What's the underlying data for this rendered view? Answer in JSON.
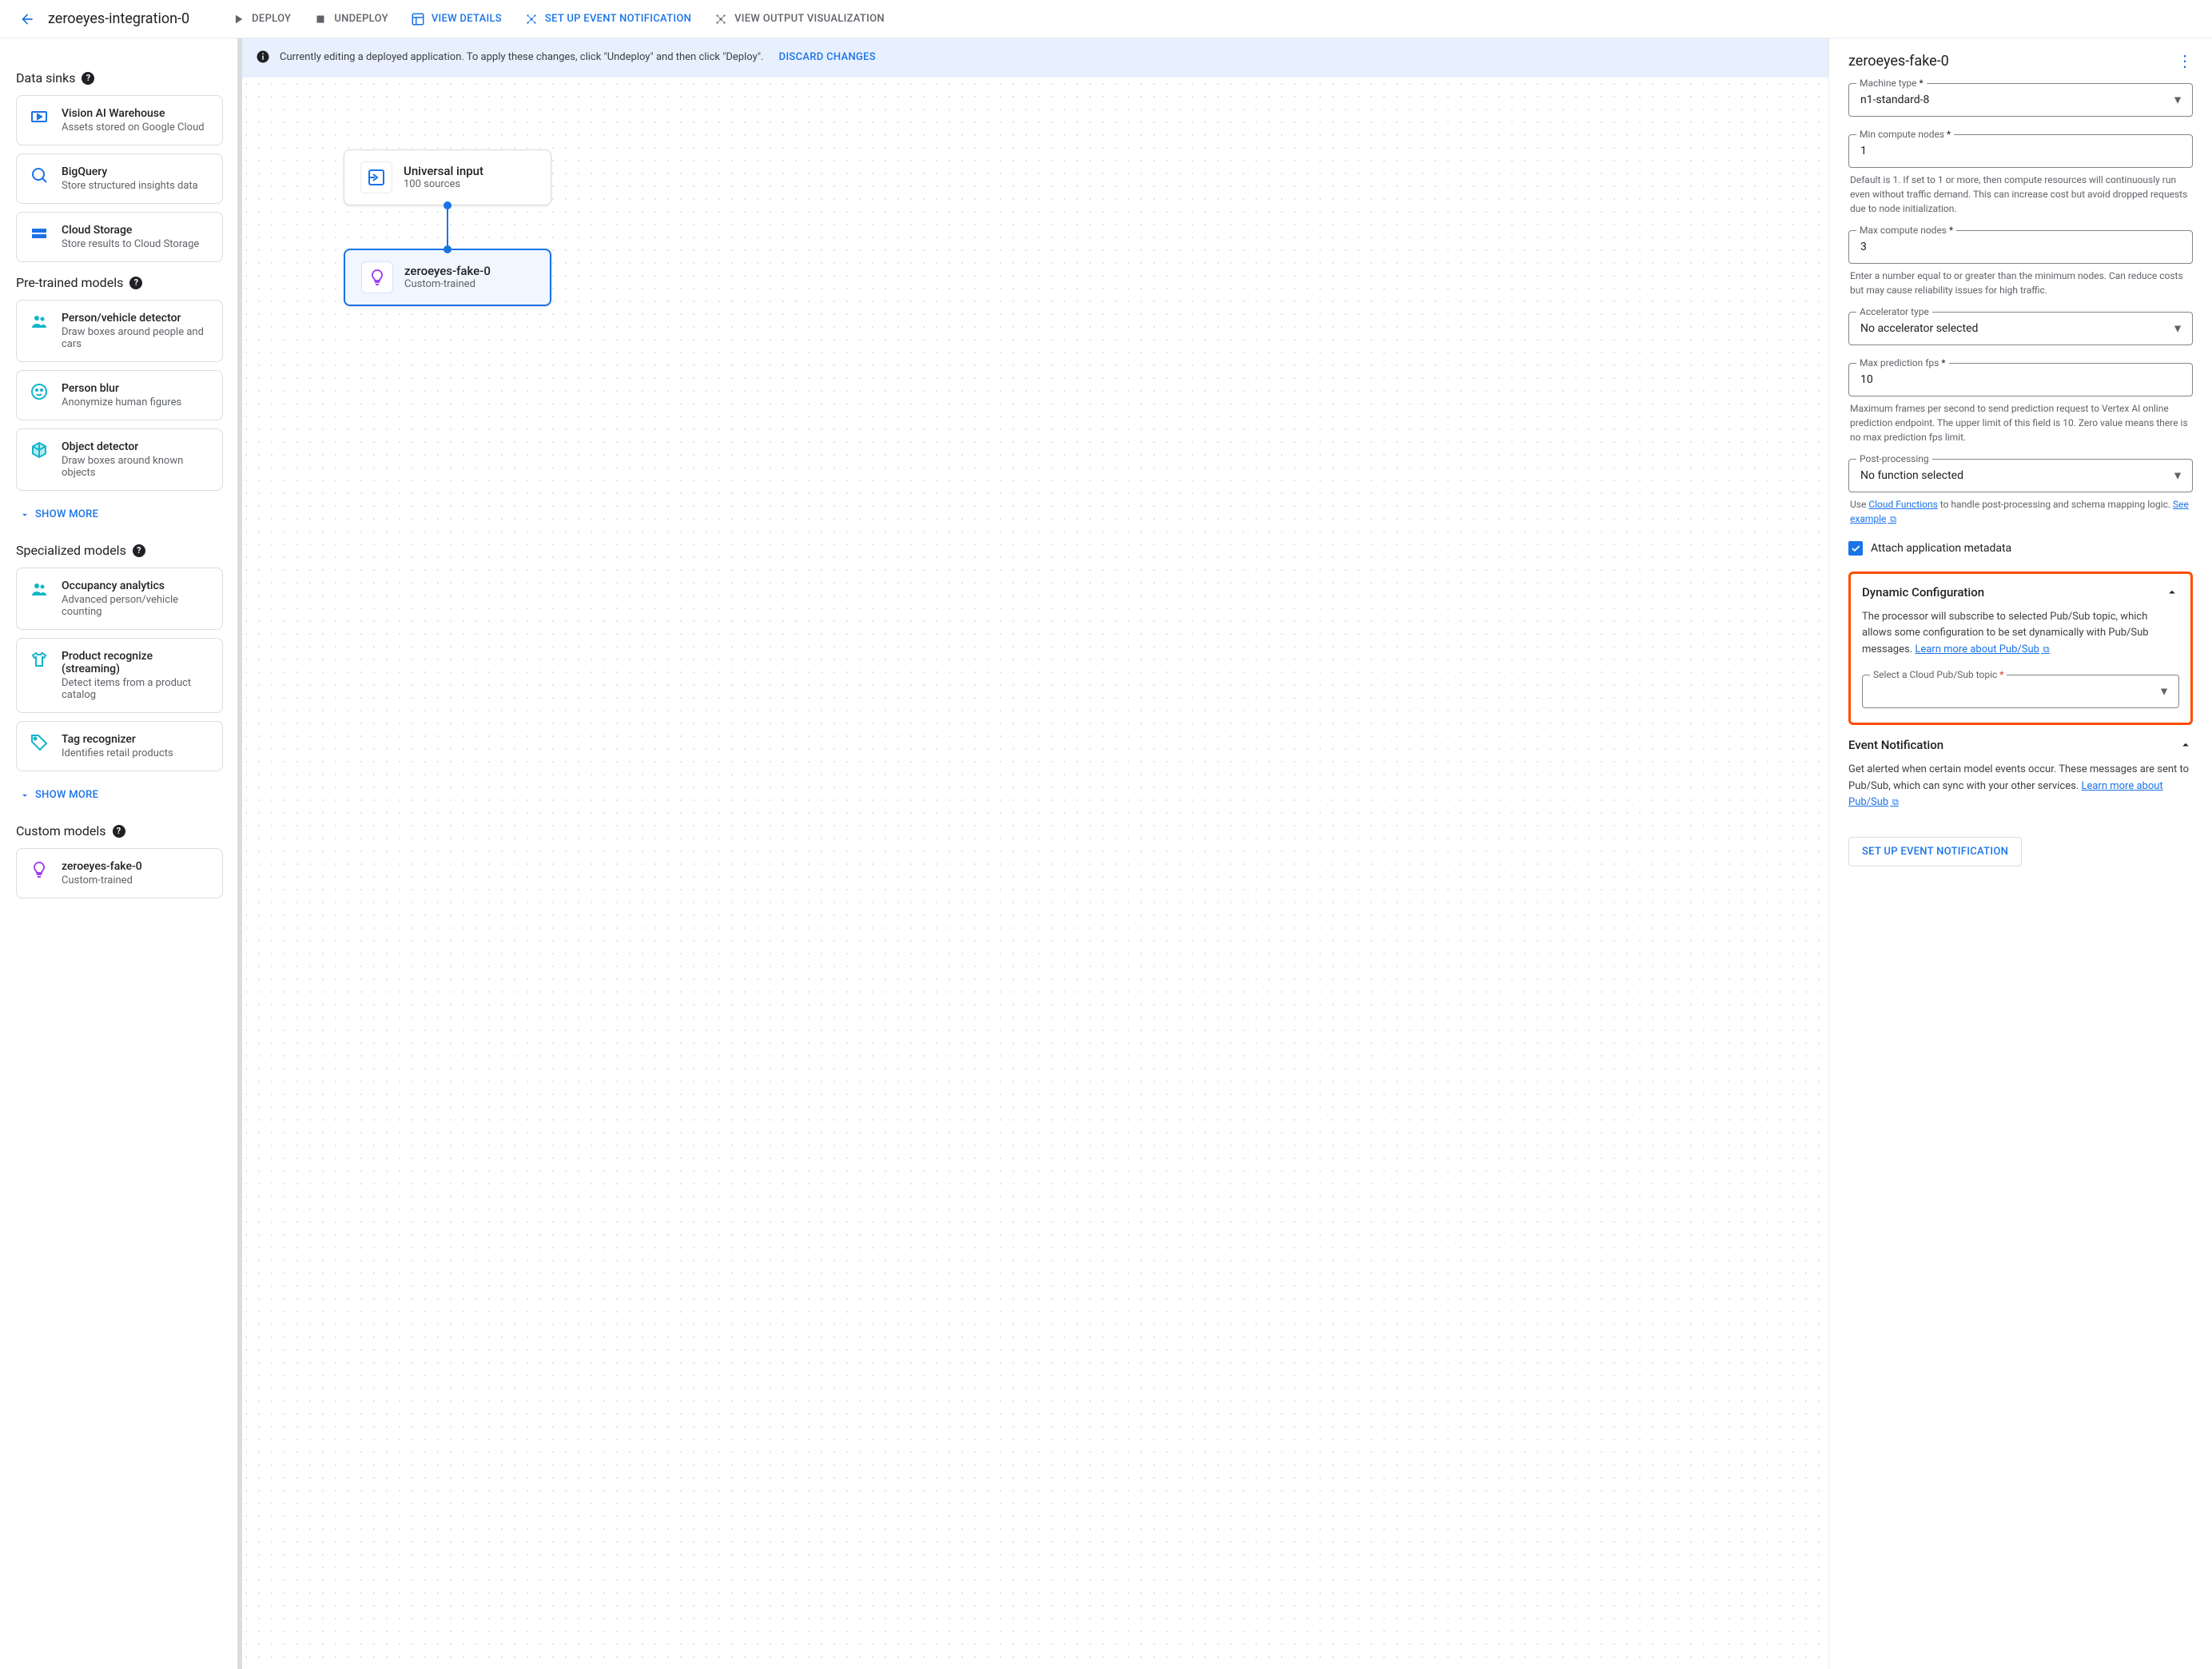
{
  "header": {
    "appName": "zeroeyes-integration-0",
    "actions": {
      "deploy": "DEPLOY",
      "undeploy": "UNDEPLOY",
      "viewDetails": "VIEW DETAILS",
      "setupEvent": "SET UP EVENT NOTIFICATION",
      "viewOutput": "VIEW OUTPUT VISUALIZATION"
    }
  },
  "sidebar": {
    "sections": {
      "dataSinks": {
        "title": "Data sinks",
        "items": [
          {
            "title": "Vision AI Warehouse",
            "sub": "Assets stored on Google Cloud"
          },
          {
            "title": "BigQuery",
            "sub": "Store structured insights data"
          },
          {
            "title": "Cloud Storage",
            "sub": "Store results to Cloud Storage"
          }
        ]
      },
      "pretrained": {
        "title": "Pre-trained models",
        "items": [
          {
            "title": "Person/vehicle detector",
            "sub": "Draw boxes around people and cars"
          },
          {
            "title": "Person blur",
            "sub": "Anonymize human figures"
          },
          {
            "title": "Object detector",
            "sub": "Draw boxes around known objects"
          }
        ],
        "showMore": "SHOW MORE"
      },
      "specialized": {
        "title": "Specialized models",
        "items": [
          {
            "title": "Occupancy analytics",
            "sub": "Advanced person/vehicle counting"
          },
          {
            "title": "Product recognize (streaming)",
            "sub": "Detect items from a product catalog"
          },
          {
            "title": "Tag recognizer",
            "sub": "Identifies retail products"
          }
        ],
        "showMore": "SHOW MORE"
      },
      "custom": {
        "title": "Custom models",
        "items": [
          {
            "title": "zeroeyes-fake-0",
            "sub": "Custom-trained"
          }
        ]
      }
    }
  },
  "canvas": {
    "banner": {
      "text": "Currently editing a deployed application. To apply these changes, click \"Undeploy\" and then click \"Deploy\".",
      "discard": "DISCARD CHANGES"
    },
    "nodes": {
      "input": {
        "title": "Universal input",
        "sub": "100 sources"
      },
      "model": {
        "title": "zeroeyes-fake-0",
        "sub": "Custom-trained"
      }
    }
  },
  "panel": {
    "title": "zeroeyes-fake-0",
    "fields": {
      "machineType": {
        "label": "Machine type",
        "value": "n1-standard-8"
      },
      "minNodes": {
        "label": "Min compute nodes",
        "value": "1",
        "help": "Default is 1. If set to 1 or more, then compute resources will continuously run even without traffic demand. This can increase cost but avoid dropped requests due to node initialization."
      },
      "maxNodes": {
        "label": "Max compute nodes",
        "value": "3",
        "help": "Enter a number equal to or greater than the minimum nodes. Can reduce costs but may cause reliability issues for high traffic."
      },
      "accelerator": {
        "label": "Accelerator type",
        "value": "No accelerator selected"
      },
      "maxFps": {
        "label": "Max prediction fps",
        "value": "10",
        "help": "Maximum frames per second to send prediction request to Vertex AI online prediction endpoint. The upper limit of this field is 10. Zero value means there is no max prediction fps limit."
      },
      "postProcessing": {
        "label": "Post-processing",
        "value": "No function selected",
        "helpPrefix": "Use ",
        "helpLink1": "Cloud Functions",
        "helpMid": " to handle post-processing and schema mapping logic. ",
        "helpLink2": "See example"
      }
    },
    "attachMetadata": "Attach application metadata",
    "dynamicConfig": {
      "title": "Dynamic Configuration",
      "desc": "The processor will subscribe to selected Pub/Sub topic, which allows some configuration to be set dynamically with Pub/Sub messages. ",
      "link": "Learn more about Pub/Sub",
      "selectLabel": "Select a Cloud Pub/Sub topic"
    },
    "eventNotification": {
      "title": "Event Notification",
      "desc": "Get alerted when certain model events occur. These messages are sent to Pub/Sub, which can sync with your other services. ",
      "link": "Learn more about Pub/Sub",
      "button": "SET UP EVENT NOTIFICATION"
    }
  }
}
